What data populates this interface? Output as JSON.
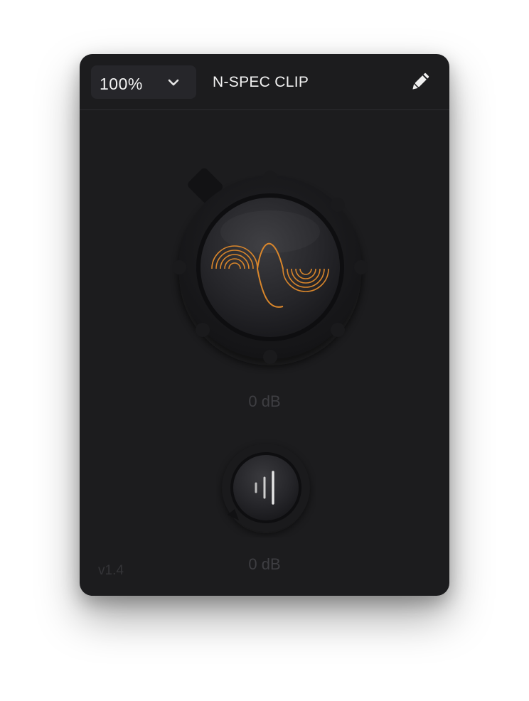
{
  "header": {
    "zoom": "100%",
    "title": "N-SPEC CLIP"
  },
  "icons": {
    "zoom_dropdown": "chevron-down-icon",
    "edit": "pencil-icon",
    "main_knob_logo": "sine-wave-icon",
    "output_knob_logo": "level-bars-icon"
  },
  "knobs": {
    "main_value": "0 dB",
    "output_value": "0 dB"
  },
  "footer": {
    "version": "v1.4"
  },
  "colors": {
    "background": "#1c1c1e",
    "accent": "#e08a2c",
    "text": "#f2f2f2",
    "muted": "#3e3e42"
  }
}
